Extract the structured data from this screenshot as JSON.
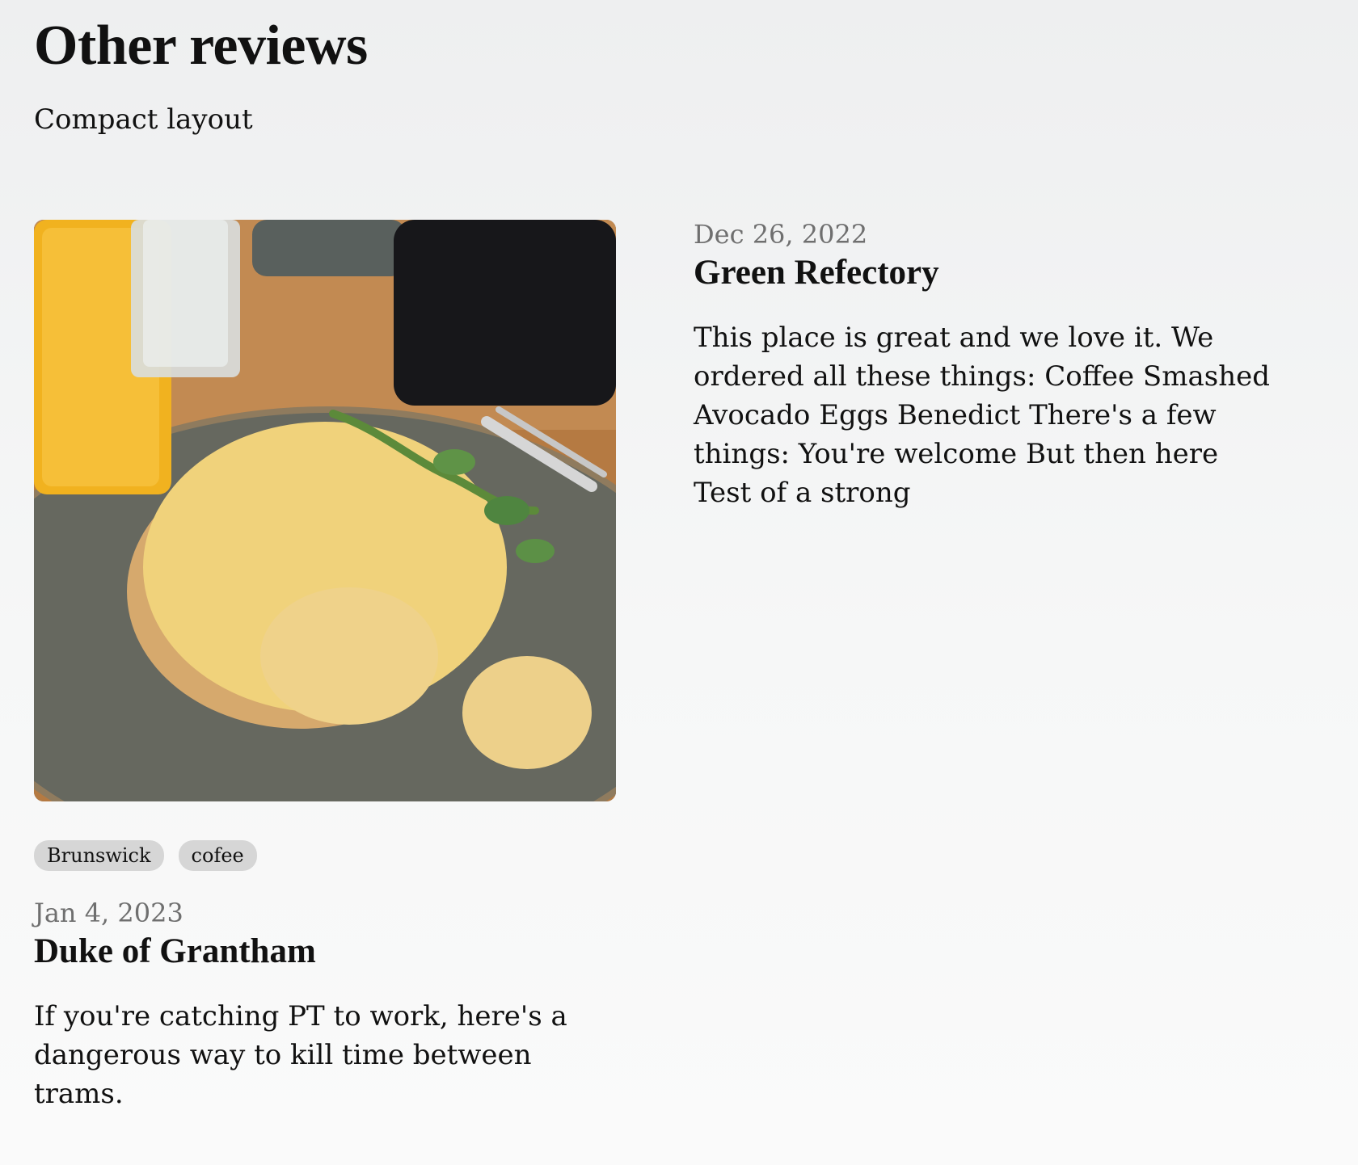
{
  "header": {
    "title": "Other reviews",
    "subtitle": "Compact layout"
  },
  "reviews": [
    {
      "date": "Jan 4, 2023",
      "title": "Duke of Grantham",
      "excerpt": "If you're catching PT to work, here's a dangerous way to kill time between trams.",
      "tags": [
        "Brunswick",
        "cofee"
      ],
      "image": "scrambled eggs on toast"
    },
    {
      "date": "Dec 26, 2022",
      "title": "Green Refectory",
      "excerpt": "This place is great and we love it. We ordered all these things: Coffee Smashed Avocado Eggs Benedict There's a few things: You're welcome But then here Test of a strong"
    }
  ]
}
